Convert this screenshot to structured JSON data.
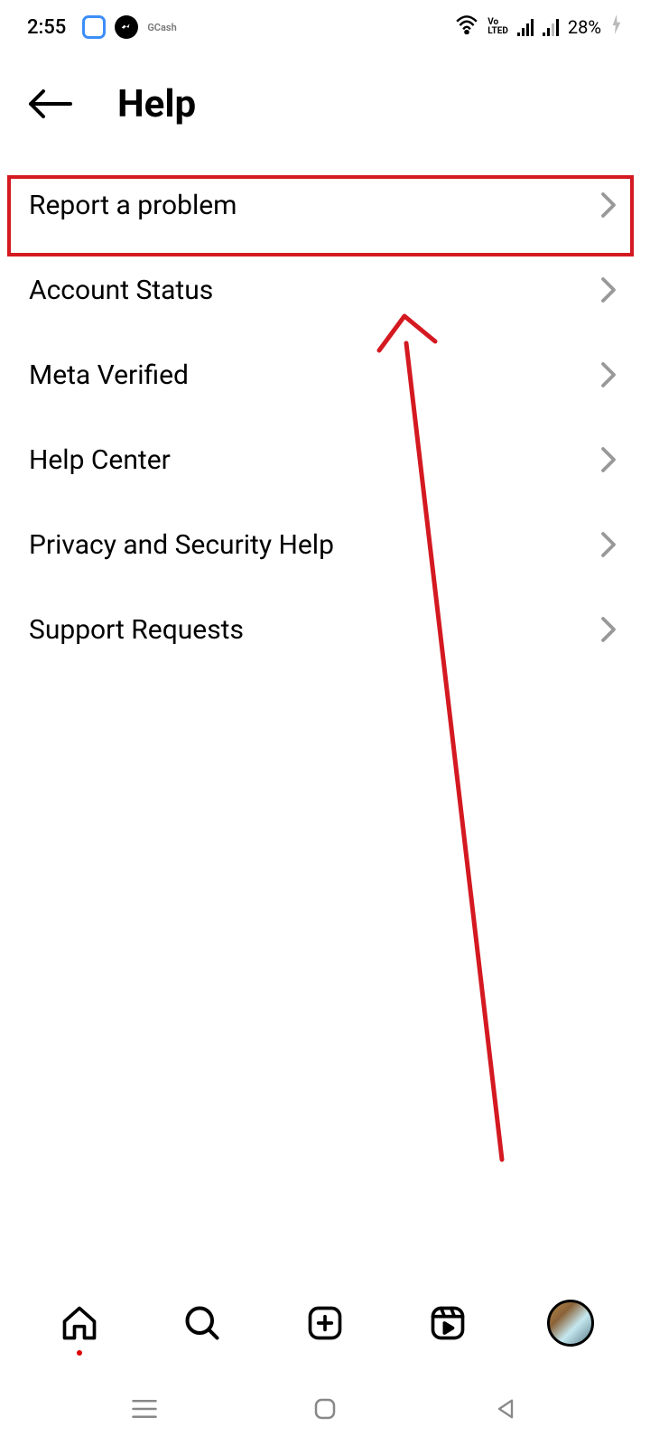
{
  "status": {
    "time": "2:55",
    "gcash": "GCash",
    "battery": "28%",
    "volte_line1": "Vo",
    "volte_line2": "LTED"
  },
  "header": {
    "title": "Help"
  },
  "menu": {
    "items": [
      {
        "label": "Report a problem"
      },
      {
        "label": "Account Status"
      },
      {
        "label": "Meta Verified"
      },
      {
        "label": "Help Center"
      },
      {
        "label": "Privacy and Security Help"
      },
      {
        "label": "Support Requests"
      }
    ]
  },
  "annotation": {
    "highlight_color": "#d41921"
  }
}
